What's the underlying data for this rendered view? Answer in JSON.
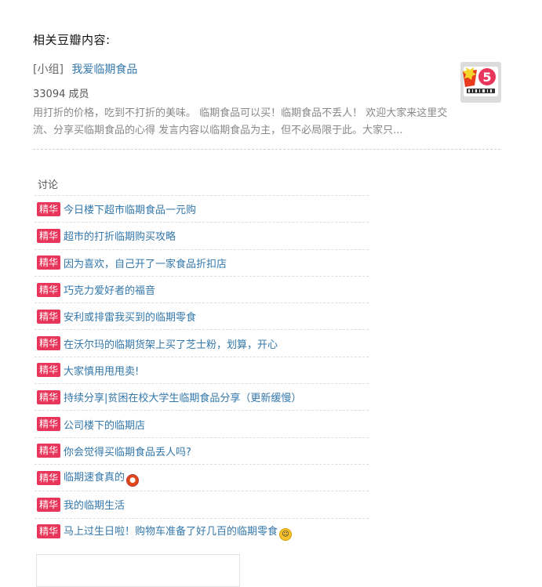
{
  "section": {
    "title": "相关豆瓣内容:"
  },
  "group": {
    "tag": "[小组]",
    "name": "我爱临期食品",
    "members": "33094 成员",
    "description": "用打折的价格，吃到不打折的美味。 临期食品可以买！临期食品不丢人！ 欢迎大家来这里交流、分享买临期食品的心得 发言内容以临期食品为主，但不必局限于此。大家只...",
    "thumb_text": "5"
  },
  "discussion": {
    "title": "讨论",
    "badge": "精华",
    "topics": [
      {
        "title": "今日楼下超市临期食品一元购"
      },
      {
        "title": "超市的打折临期购买攻略"
      },
      {
        "title": "因为喜欢，自己开了一家食品折扣店"
      },
      {
        "title": "巧克力爱好者的福音"
      },
      {
        "title": "安利或排雷我买到的临期零食"
      },
      {
        "title": "在沃尔玛的临期货架上买了芝士粉，划算，开心"
      },
      {
        "title": "大家慎用甩甩卖!"
      },
      {
        "title": "持续分享|贫困在校大学生临期食品分享（更新缓慢）"
      },
      {
        "title": "公司楼下的临期店"
      },
      {
        "title": "你会觉得买临期食品丢人吗?"
      },
      {
        "title": "临期速食真的",
        "emoji": "red-face-emoji"
      },
      {
        "title": "我的临期生活"
      },
      {
        "title": "马上过生日啦！购物车准备了好几百的临期零食",
        "emoji": "grin-emoji"
      }
    ]
  },
  "colors": {
    "link": "#3377aa",
    "badge": "#e8355a"
  }
}
